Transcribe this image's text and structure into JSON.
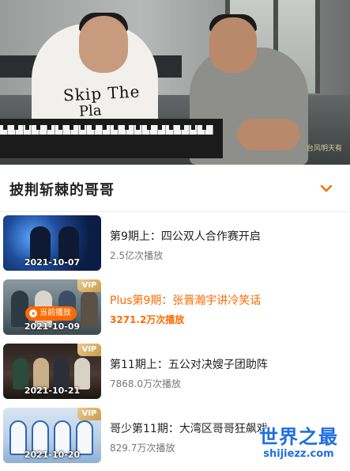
{
  "player": {
    "shirt_text_line1": "Skip The",
    "shirt_text_line2": "Pla",
    "watermark": "台风明天有"
  },
  "section": {
    "title": "披荆斩棘的哥哥",
    "collapse_icon": "chevron-down-icon"
  },
  "episodes": [
    {
      "title": "第9期上：四公双人合作赛开启",
      "views": "2.5亿次播放",
      "date": "2021-10-07",
      "vip": false,
      "active": false
    },
    {
      "title": "Plus第9期：张晋瀚宇讲冷笑话",
      "views": "3271.2万次播放",
      "date": "2021-10-09",
      "vip": true,
      "vip_label": "VIP",
      "active": true,
      "now_playing_label": "当前播放"
    },
    {
      "title": "第11期上：五公对决嫂子团助阵",
      "views": "7868.0万次播放",
      "date": "2021-10-21",
      "vip": true,
      "vip_label": "VIP",
      "active": false
    },
    {
      "title": "哥少第11期：大湾区哥哥狂飙戏",
      "views": "829.7万次播放",
      "date": "2021-10-20",
      "vip": true,
      "vip_label": "VIP",
      "active": false
    }
  ],
  "colors": {
    "accent": "#ff6a00",
    "vip_gold": "#d4aa62",
    "logo_blue": "#1f6fe0"
  },
  "site_logo": {
    "cn": "世界之最",
    "en": "shijiezz.com"
  }
}
